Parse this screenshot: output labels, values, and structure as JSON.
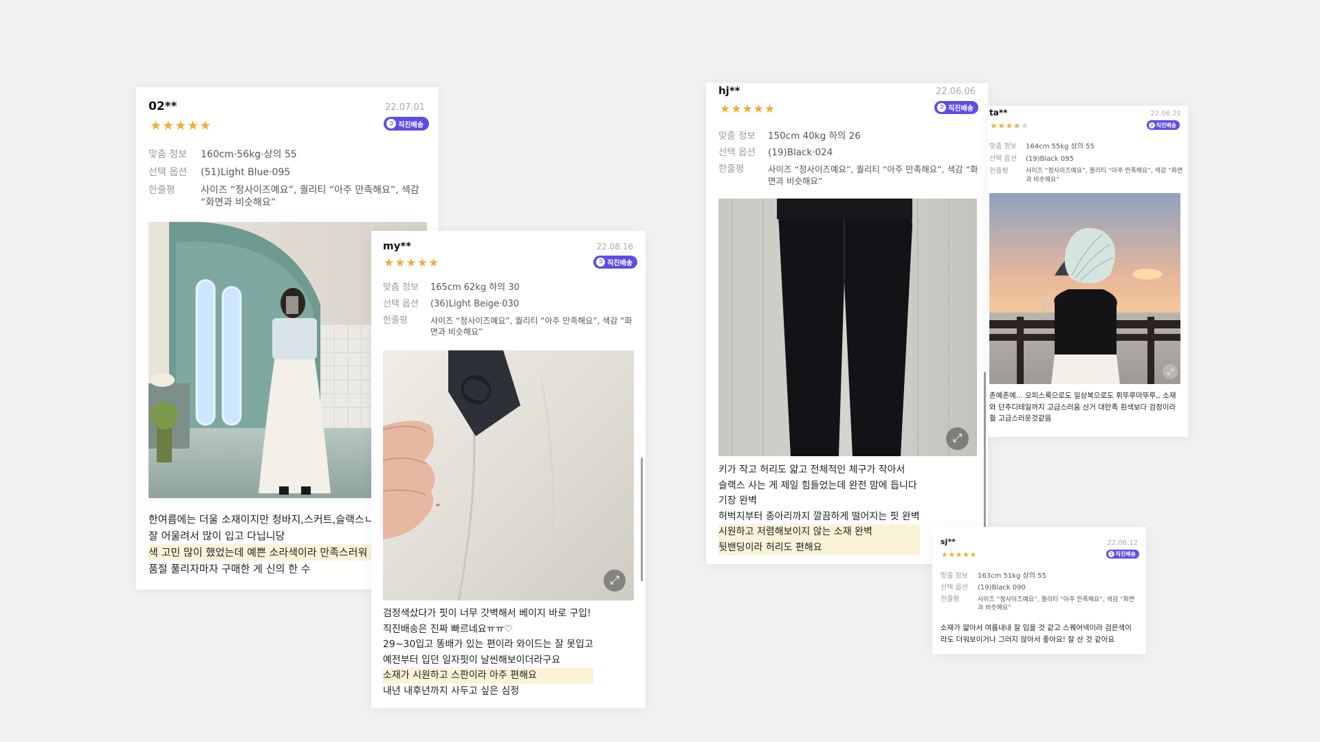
{
  "labels": {
    "fit_info": "맞춤 정보",
    "option": "선택 옵션",
    "one_line": "한줄평"
  },
  "reviews": [
    {
      "user": "02**",
      "date": "22.07.01",
      "stars": "★★★★★",
      "badge": "직진배송",
      "fit": "160cm·56kg·상의 55",
      "option": "(51)Light Blue·095",
      "one_line": "사이즈 “정사이즈예요”, 퀄리티 “아주 만족해요”, 색감 “화면과 비슷해요”",
      "lines": [
        "한여름에는 더울 소재이지만 청바지,스커트,슬랙스ㄴ",
        "잘 어울려서 많이 입고 다닙니당",
        "색 고민 많이 했었는데 예쁜 소라색이라 만족스러워",
        "품절 풀리자마자 구매한 게 신의 한 수"
      ]
    },
    {
      "user": "my**",
      "date": "22.08.16",
      "stars": "★★★★★",
      "badge": "직진배송",
      "fit": "165cm 62kg 하의 30",
      "option": "(36)Light Beige·030",
      "one_line": "사이즈 “정사이즈예요”, 퀄리티 “아주 만족해요”, 색감 “화면과 비슷해요”",
      "tag_text": "O",
      "lines": [
        "검정색샀다가 핏이 너무 갓벽해서 베이지 바로 구입!",
        "직진배송은 진짜 빠르네요ㅠㅠ♡",
        "29~30입고 똥배가 있는 편이라 와이드는 잘 못입고",
        "예전부터 입던 일자핏이 날씬해보이더라구요",
        "소재가 시원하고 스판이라 아주 편해요",
        "내년 내후년까지 사두고 싶은 심정"
      ]
    },
    {
      "user": "hj**",
      "date": "22.06.06",
      "stars": "★★★★★",
      "badge": "직진배송",
      "fit": "150cm 40kg 하의 26",
      "option": "(19)Black·024",
      "one_line": "사이즈 “정사이즈예요”, 퀄리티 “아주 만족해요”, 색감 “화면과 비슷해요”",
      "lines": [
        "키가 작고 허리도 얇고 전체적인 체구가 작아서",
        "슬랙스 사는 게 제일 힘들었는데 완전 맘에 듭니다",
        "기장 완벽",
        "허벅지부터 종아리까지 깔끔하게 떨어지는 핏 완벽",
        "시원하고 저렴해보이지 않는 소재 완벽",
        "뒷밴딩이라 허리도 편해요"
      ]
    },
    {
      "user": "ta**",
      "date": "22.06.20",
      "stars": "★★★★",
      "star_empty": "★",
      "badge": "직진배송",
      "fit": "164cm 55kg 상의 55",
      "option": "(19)Black 095",
      "one_line": "사이즈 “정사이즈예요”, 퀄리티 “아주 만족해요”, 색감 “화면과 비슷해요”",
      "lines": [
        "존예존예... 오피스룩으로도 일상복으로도 휘뚜루마뚜루,, 소재",
        "와 단추디테일까지 고급스러움 산거 대만족 흰색보다 검정이라",
        "훨 고급스러운것같음"
      ]
    },
    {
      "user": "sj**",
      "date": "22.06.12",
      "stars": "★★★★★",
      "badge": "직진배송",
      "fit": "163cm 51kg 상의 55",
      "option": "(19)Black 090",
      "one_line": "사이즈 “정사이즈예요”, 퀄리티 “아주 만족해요”, 색감 “화면과 비슷해요”",
      "lines": [
        "소재가 얇아서 여름내내 잘 입을 것 같고 스퀘어넥이라 검은색이",
        "라도 더워보이거나 그러지 않아서 좋아요! 잘 산 것 같아요"
      ]
    }
  ],
  "colors": {
    "star": "#f0ad3c",
    "badge": "#5b4ee6",
    "highlight": "#fbf3d8",
    "background": "#f1f1f2"
  }
}
